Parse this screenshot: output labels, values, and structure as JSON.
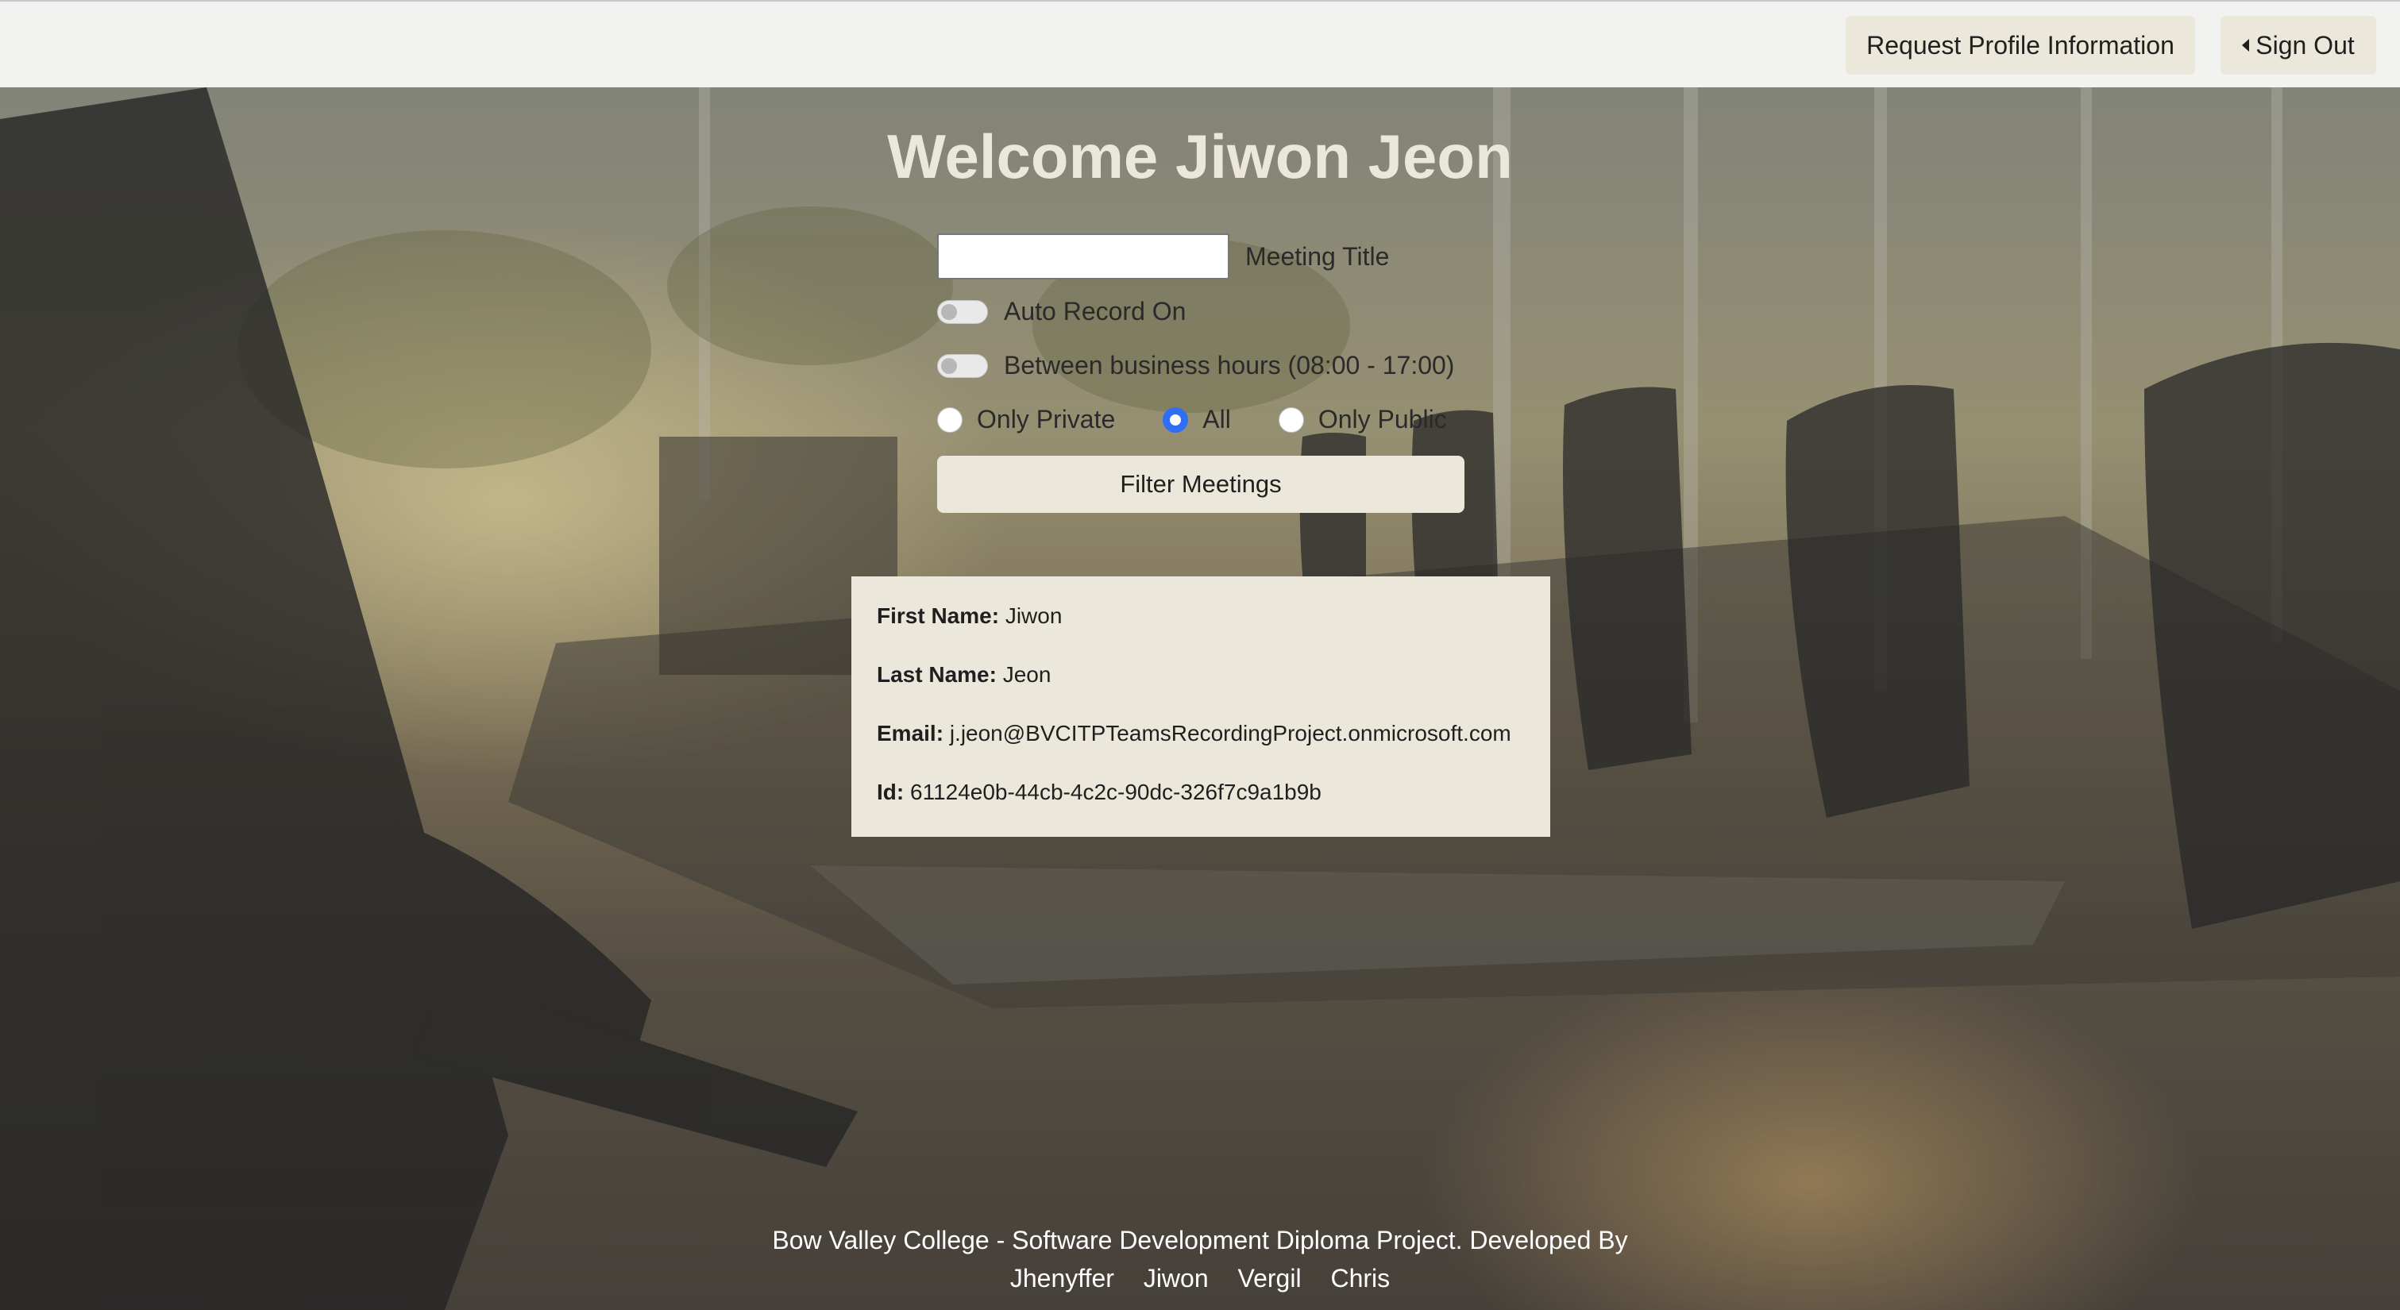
{
  "header": {
    "profile_button": "Request Profile Information",
    "signout_button": "Sign Out"
  },
  "welcome": "Welcome Jiwon Jeon",
  "filters": {
    "meeting_title_value": "",
    "meeting_title_label": "Meeting Title",
    "auto_record_label": "Auto Record On",
    "auto_record_on": false,
    "business_hours_label": "Between business hours (08:00 - 17:00)",
    "business_hours_on": false,
    "visibility_options": [
      "Only Private",
      "All",
      "Only Public"
    ],
    "visibility_selected": "All",
    "filter_button": "Filter Meetings"
  },
  "profile": {
    "first_name_label": "First Name:",
    "first_name": "Jiwon",
    "last_name_label": "Last Name:",
    "last_name": "Jeon",
    "email_label": "Email:",
    "email": "j.jeon@BVCITPTeamsRecordingProject.onmicrosoft.com",
    "id_label": "Id:",
    "id": "61124e0b-44cb-4c2c-90dc-326f7c9a1b9b"
  },
  "footer": {
    "credit": "Bow Valley College - Software Development Diploma Project. Developed By",
    "developers": [
      "Jhenyffer",
      "Jiwon",
      "Vergil",
      "Chris"
    ]
  },
  "colors": {
    "accent": "#2f6ef5",
    "panel": "#ebe8db",
    "topbar": "#f2f2f1"
  }
}
